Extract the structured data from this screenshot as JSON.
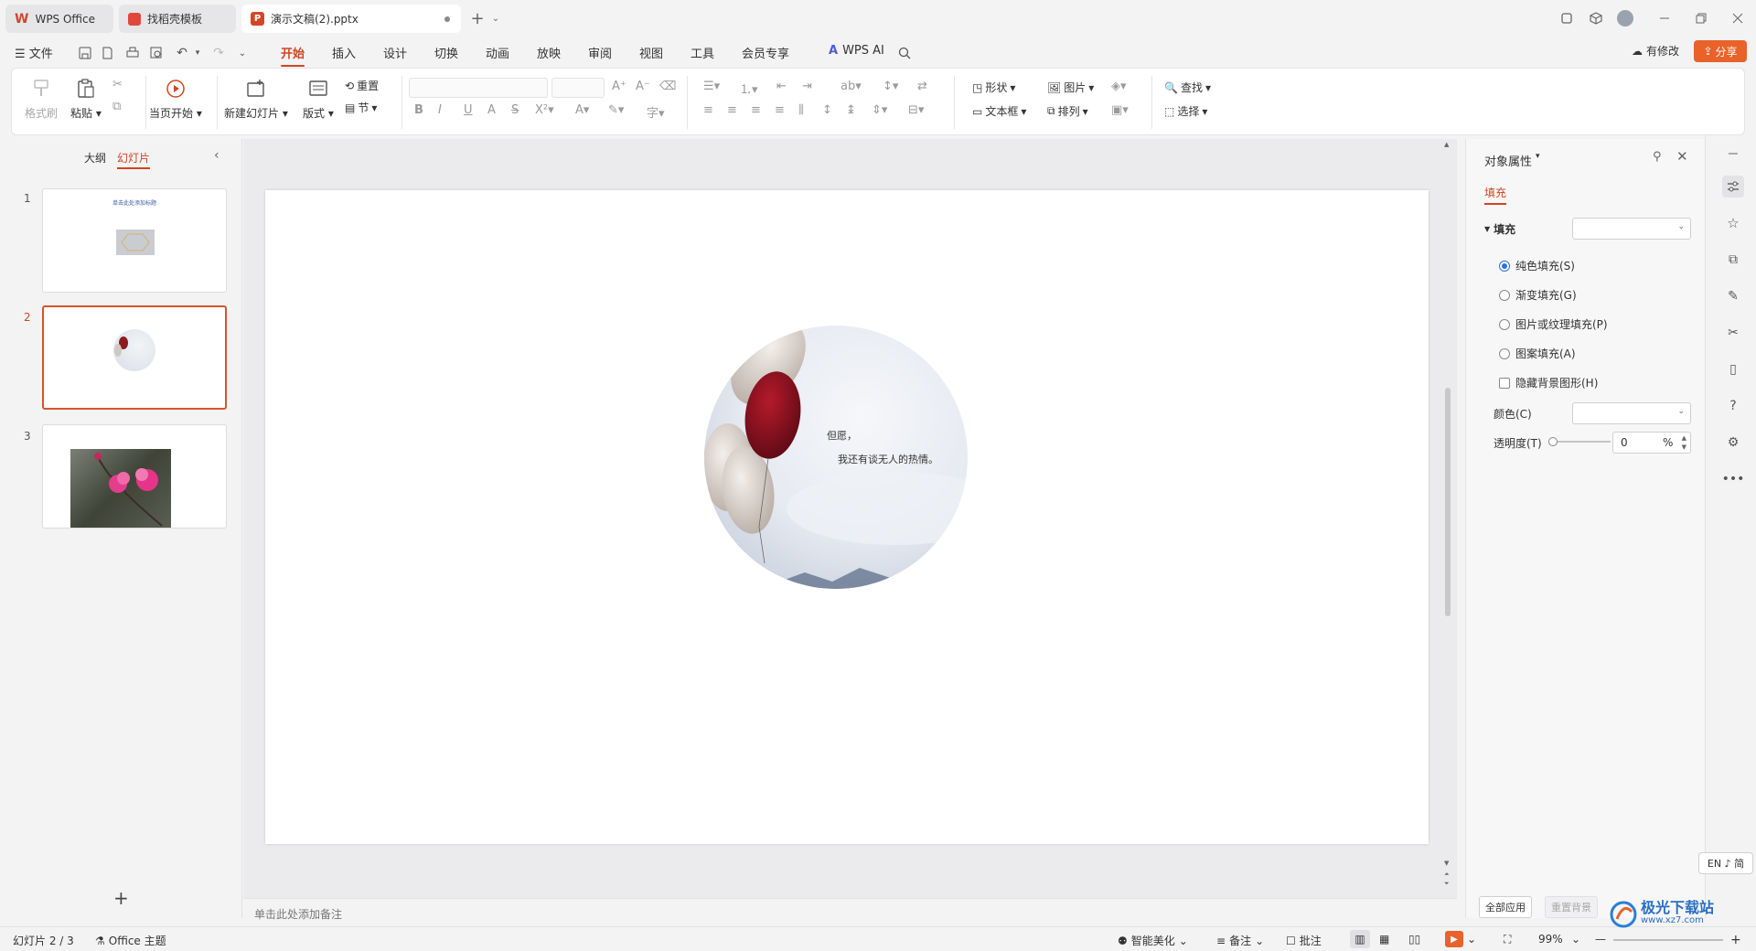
{
  "tabs": [
    {
      "label": "WPS Office"
    },
    {
      "label": "找稻壳模板"
    },
    {
      "label": "演示文稿(2).pptx"
    }
  ],
  "menu": {
    "file": "文件",
    "items": [
      "开始",
      "插入",
      "设计",
      "切换",
      "动画",
      "放映",
      "审阅",
      "视图",
      "工具",
      "会员专享"
    ],
    "wps_ai": "WPS AI",
    "has_changes": "有修改",
    "share": "分享"
  },
  "ribbon": {
    "format_painter": "格式刷",
    "paste": "粘贴",
    "play_from_current": "当页开始",
    "new_slide": "新建幻灯片",
    "layout": "版式",
    "reset": "重置",
    "section": "节",
    "shape": "形状",
    "picture": "图片",
    "textbox": "文本框",
    "arrange": "排列",
    "find": "查找",
    "select": "选择"
  },
  "left_pane": {
    "outline_tab": "大纲",
    "slides_tab": "幻灯片",
    "slide_numbers": [
      "1",
      "2",
      "3"
    ],
    "slide1_title": "单击此处添加标题"
  },
  "slide": {
    "text_line1": "但愿，",
    "text_line2": "我还有谈无人的热情。"
  },
  "notes": {
    "placeholder": "单击此处添加备注"
  },
  "object_properties": {
    "title": "对象属性",
    "tab_fill": "填充",
    "section_fill": "填充",
    "options": [
      "纯色填充(S)",
      "渐变填充(G)",
      "图片或纹理填充(P)",
      "图案填充(A)"
    ],
    "selected_option": "纯色填充(S)",
    "hide_bg_graphics": "隐藏背景图形(H)",
    "color_label": "颜色(C)",
    "transparency_label": "透明度(T)",
    "transparency_value": "0",
    "transparency_unit": "%",
    "apply_all": "全部应用",
    "reset_bg": "重置背景"
  },
  "ime": {
    "label": "EN ♪ 简"
  },
  "status": {
    "slide_counter": "幻灯片 2 / 3",
    "theme": "Office 主题",
    "smart_beautify": "智能美化",
    "notes": "备注",
    "comments": "批注",
    "zoom": "99%"
  },
  "watermark": {
    "text": "极光下载站",
    "url": "www.xz7.com"
  },
  "colors": {
    "accent": "#d0461f",
    "share_bg": "#e8622a",
    "selected_radio": "#2f6fd8"
  }
}
